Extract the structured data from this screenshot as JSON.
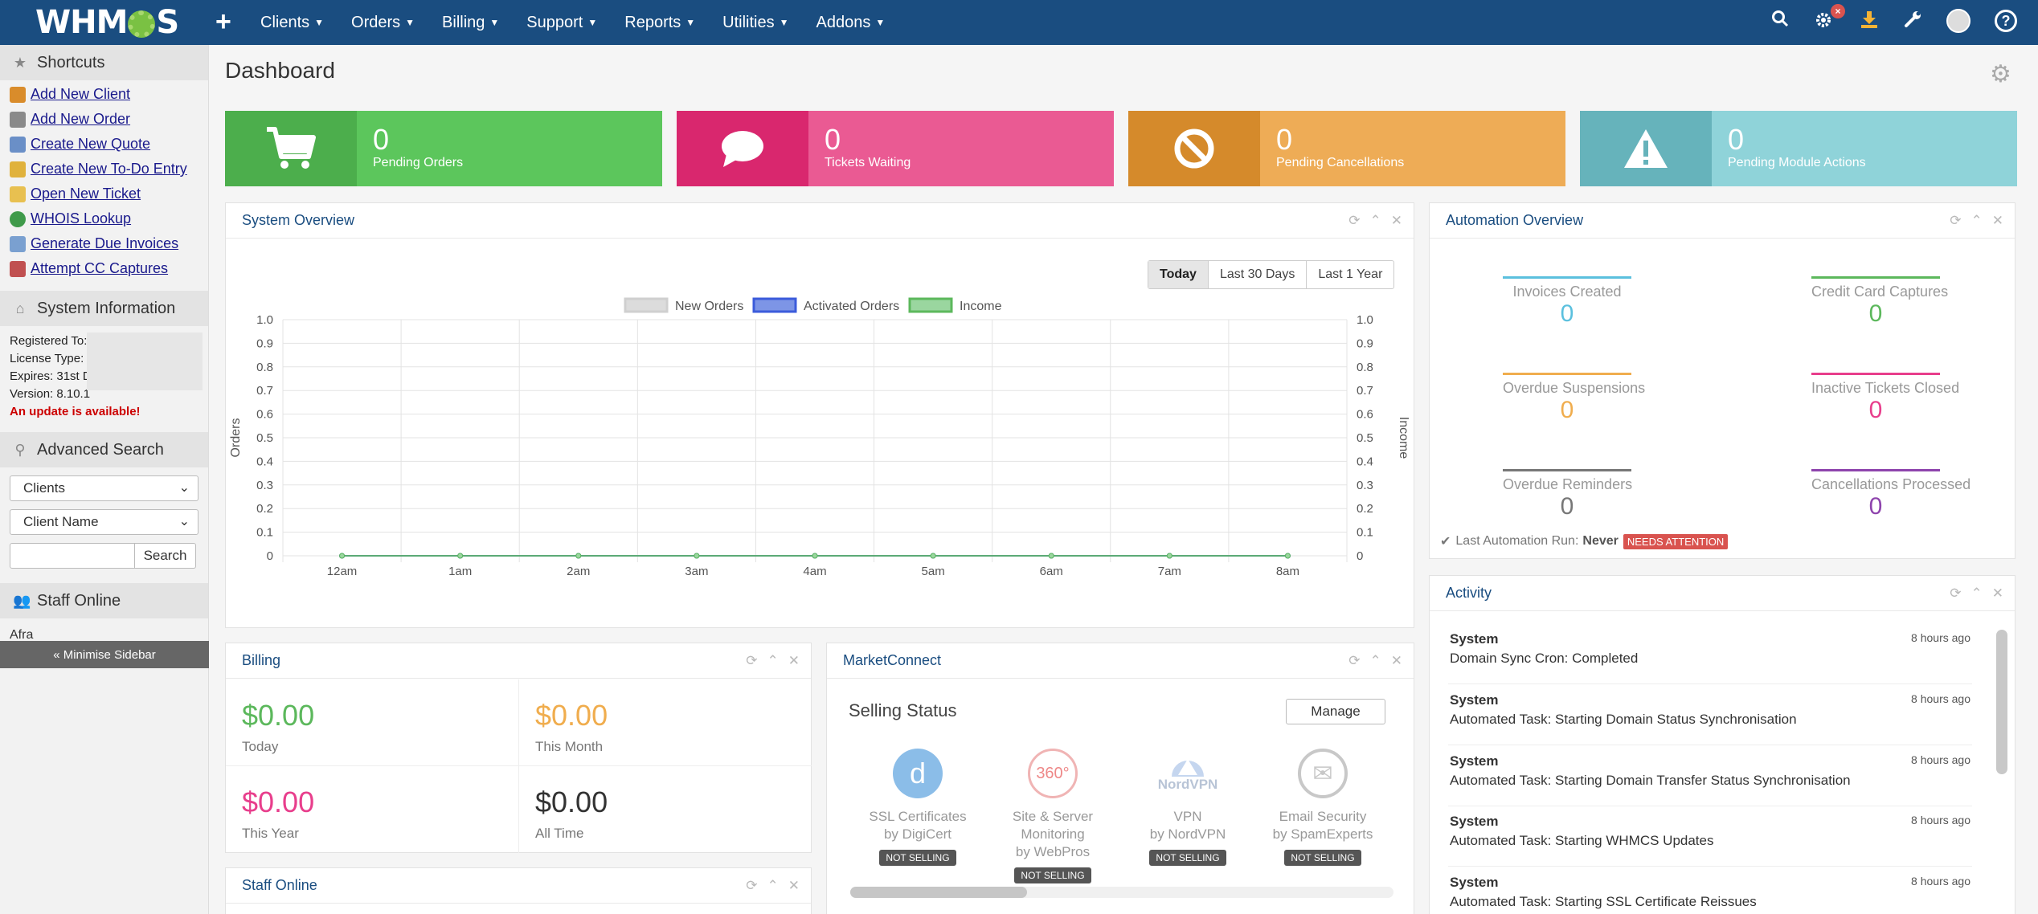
{
  "brand": {
    "logo_text_left": "WHM",
    "logo_text_right": "S"
  },
  "nav": {
    "plus": "+",
    "menu": [
      "Clients",
      "Orders",
      "Billing",
      "Support",
      "Reports",
      "Utilities",
      "Addons"
    ],
    "badge": "×"
  },
  "sidebar": {
    "shortcuts_title": "Shortcuts",
    "shortcuts": [
      {
        "label": "Add New Client",
        "color": "#d98c2b"
      },
      {
        "label": "Add New Order",
        "color": "#8a8a8a"
      },
      {
        "label": "Create New Quote",
        "color": "#6a8fc7"
      },
      {
        "label": "Create New To-Do Entry",
        "color": "#e0b23c"
      },
      {
        "label": "Open New Ticket",
        "color": "#e8c050"
      },
      {
        "label": "WHOIS Lookup",
        "color": "#3f9a4a"
      },
      {
        "label": "Generate Due Invoices",
        "color": "#7aa0d0"
      },
      {
        "label": "Attempt CC Captures",
        "color": "#c05050"
      }
    ],
    "sysinfo_title": "System Information",
    "sysinfo": {
      "registered": "Registered To:",
      "license": "License Type:",
      "expires": "Expires: 31st D",
      "version": "Version: 8.10.1",
      "update": "An update is available!"
    },
    "advsearch_title": "Advanced Search",
    "search_type": "Clients",
    "search_field": "Client Name",
    "search_button": "Search",
    "staff_title": "Staff Online",
    "staff_name": "Afra",
    "minimise": "« Minimise Sidebar"
  },
  "page": {
    "title": "Dashboard"
  },
  "stats": [
    {
      "value": "0",
      "label": "Pending Orders",
      "icon": "cart-icon",
      "dark": "#4cae4c",
      "light": "#5cc65c"
    },
    {
      "value": "0",
      "label": "Tickets Waiting",
      "icon": "comment-icon",
      "dark": "#d9276e",
      "light": "#ea5a93"
    },
    {
      "value": "0",
      "label": "Pending Cancellations",
      "icon": "ban-icon",
      "dark": "#d58a2b",
      "light": "#eeac56"
    },
    {
      "value": "0",
      "label": "Pending Module Actions",
      "icon": "warning-icon",
      "dark": "#66b3bb",
      "light": "#8fd3d9"
    }
  ],
  "system_overview": {
    "title": "System Overview",
    "ranges": [
      "Today",
      "Last 30 Days",
      "Last 1 Year"
    ],
    "active_range": "Today"
  },
  "chart_data": {
    "type": "line",
    "title": "",
    "x": [
      "12am",
      "1am",
      "2am",
      "3am",
      "4am",
      "5am",
      "6am",
      "7am",
      "8am"
    ],
    "series": [
      {
        "name": "New Orders",
        "values": [
          0,
          0,
          0,
          0,
          0,
          0,
          0,
          0,
          0
        ],
        "color": "#dcdcdc",
        "border": "#cfcfcf"
      },
      {
        "name": "Activated Orders",
        "values": [
          0,
          0,
          0,
          0,
          0,
          0,
          0,
          0,
          0
        ],
        "color": "#7d95e6",
        "border": "#3b5bdb"
      },
      {
        "name": "Income",
        "values": [
          0,
          0,
          0,
          0,
          0,
          0,
          0,
          0,
          0
        ],
        "color": "#9ad69f",
        "border": "#5cb85c"
      }
    ],
    "ylabel_left": "Orders",
    "ylabel_right": "Income",
    "ylim": [
      0,
      1.0
    ],
    "yticks": [
      "1.0",
      "0.9",
      "0.8",
      "0.7",
      "0.6",
      "0.5",
      "0.4",
      "0.3",
      "0.2",
      "0.1",
      "0"
    ],
    "grid": true,
    "legend": "top-center"
  },
  "automation": {
    "title": "Automation Overview",
    "items": [
      {
        "label": "Invoices Created",
        "value": "0",
        "color": "#5bc0de"
      },
      {
        "label": "Credit Card Captures",
        "value": "0",
        "color": "#5cb85c"
      },
      {
        "label": "Overdue Suspensions",
        "value": "0",
        "color": "#f0ad4e"
      },
      {
        "label": "Inactive Tickets Closed",
        "value": "0",
        "color": "#e83e8c"
      },
      {
        "label": "Overdue Reminders",
        "value": "0",
        "color": "#777777"
      },
      {
        "label": "Cancellations Processed",
        "value": "0",
        "color": "#8e44ad"
      }
    ],
    "last_run_label": "Last Automation Run:",
    "last_run_value": "Never",
    "needs_attention": "NEEDS ATTENTION"
  },
  "activity": {
    "title": "Activity",
    "items": [
      {
        "who": "System",
        "time": "8 hours ago",
        "desc": "Domain Sync Cron: Completed"
      },
      {
        "who": "System",
        "time": "8 hours ago",
        "desc": "Automated Task: Starting Domain Status Synchronisation"
      },
      {
        "who": "System",
        "time": "8 hours ago",
        "desc": "Automated Task: Starting Domain Transfer Status Synchronisation"
      },
      {
        "who": "System",
        "time": "8 hours ago",
        "desc": "Automated Task: Starting WHMCS Updates"
      },
      {
        "who": "System",
        "time": "8 hours ago",
        "desc": "Automated Task: Starting SSL Certificate Reissues"
      }
    ]
  },
  "billing": {
    "title": "Billing",
    "cells": [
      {
        "amount": "$0.00",
        "label": "Today",
        "color": "#5cb85c"
      },
      {
        "amount": "$0.00",
        "label": "This Month",
        "color": "#f0ad4e"
      },
      {
        "amount": "$0.00",
        "label": "This Year",
        "color": "#e83e8c"
      },
      {
        "amount": "$0.00",
        "label": "All Time",
        "color": "#333333"
      }
    ]
  },
  "marketconnect": {
    "title": "MarketConnect",
    "selling_status": "Selling Status",
    "manage": "Manage",
    "products": [
      {
        "name": "SSL Certificates",
        "by": "by DigiCert",
        "status": "NOT SELLING",
        "logo": "d",
        "color": "#7fb4e0"
      },
      {
        "name": "Site & Server Monitoring",
        "by": "by WebPros",
        "status": "NOT SELLING",
        "logo": "360°",
        "color": "#ffffff"
      },
      {
        "name": "VPN",
        "by": "by NordVPN",
        "status": "NOT SELLING",
        "logo": "NordVPN",
        "color": "#ffffff"
      },
      {
        "name": "Email Security",
        "by": "by SpamExperts",
        "status": "NOT SELLING",
        "logo": "✉",
        "color": "#ffffff"
      }
    ]
  },
  "staff_online_panel": {
    "title": "Staff Online"
  }
}
